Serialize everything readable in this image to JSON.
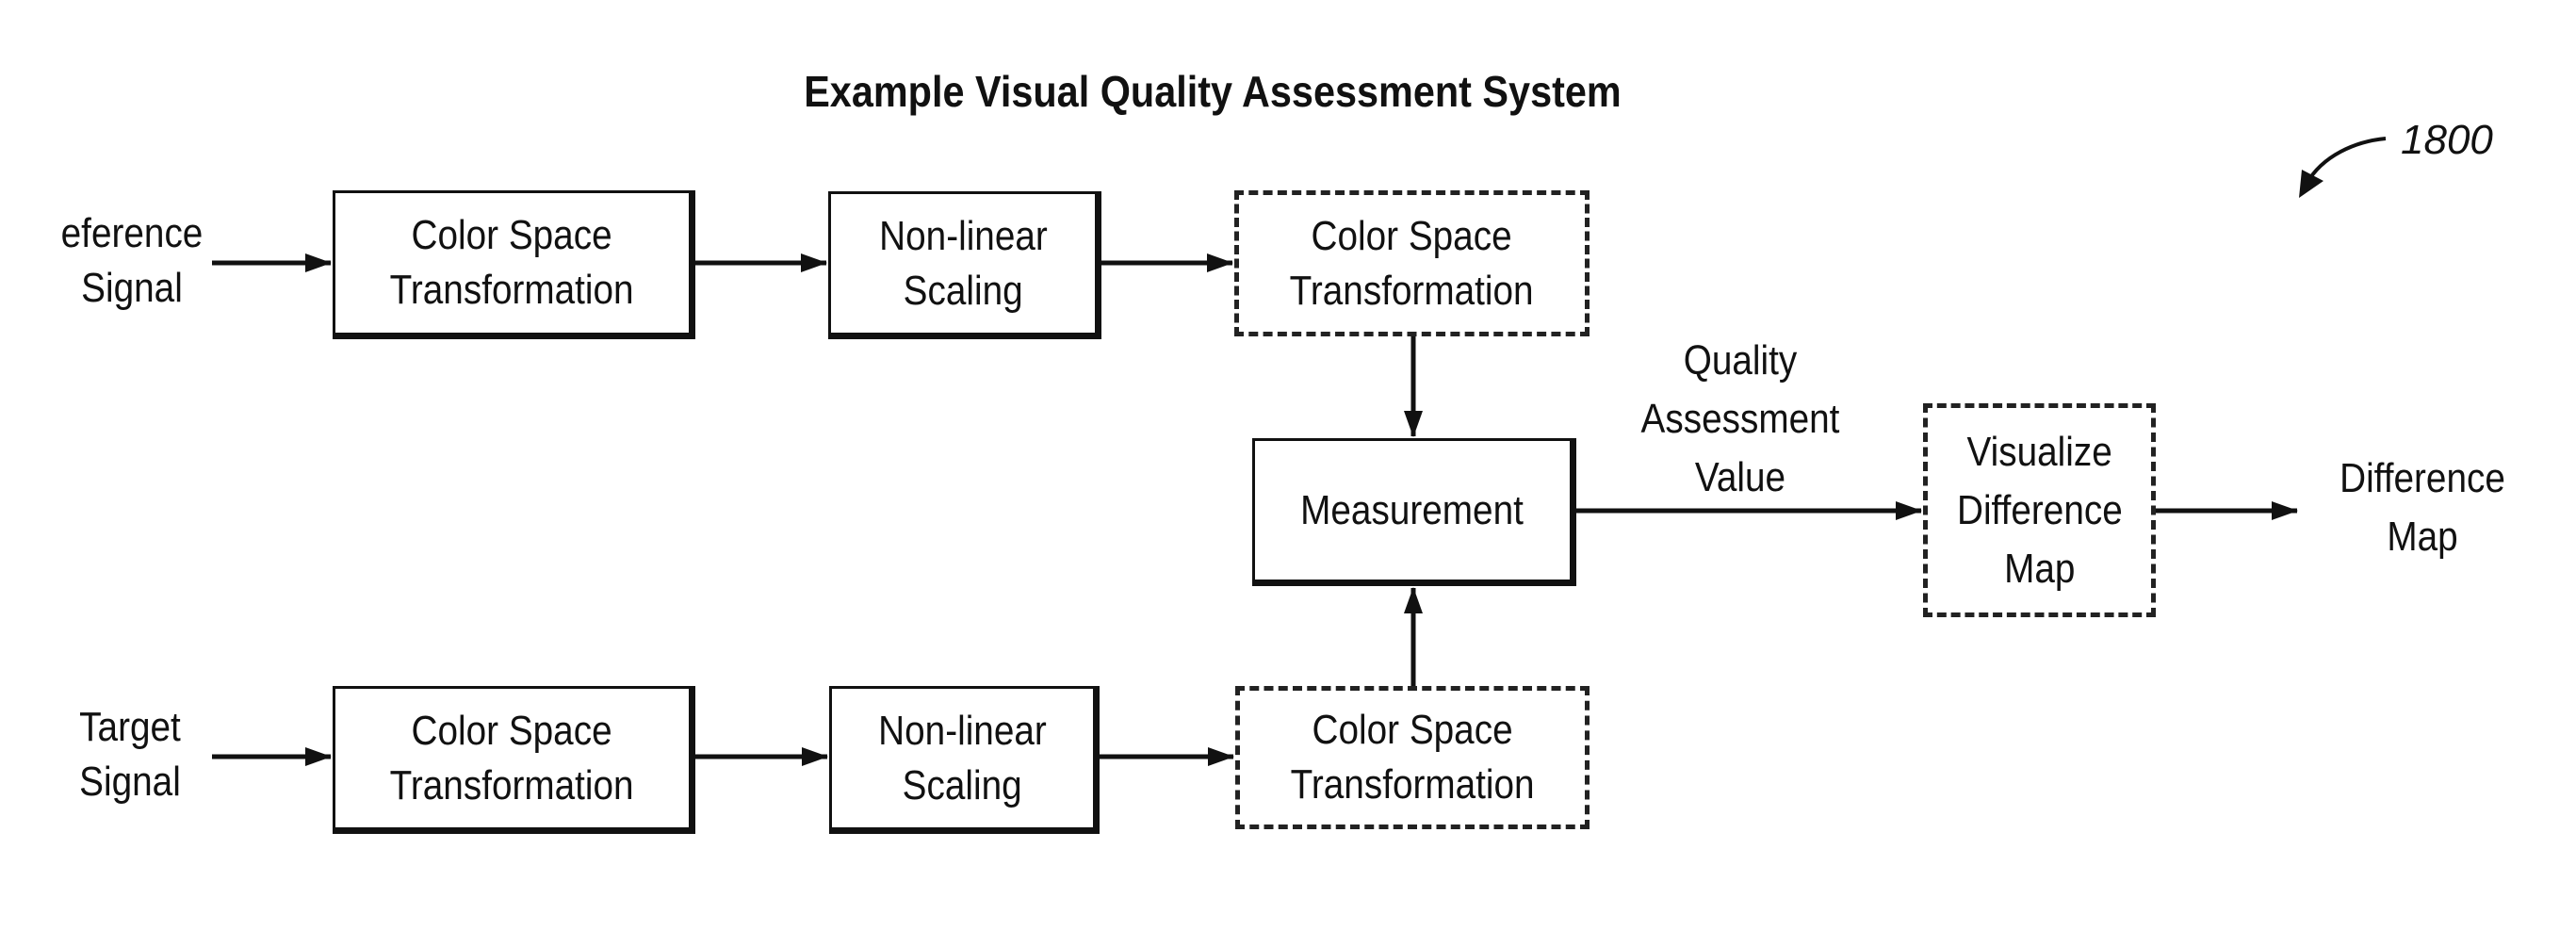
{
  "title": "Example Visual Quality Assessment System",
  "figure_number": "1800",
  "inputs": {
    "reference": [
      "eference",
      "Signal"
    ],
    "target": [
      "Target",
      "Signal"
    ]
  },
  "top_row": {
    "color_space_1": [
      "Color Space",
      "Transformation"
    ],
    "nonlinear": [
      "Non-linear",
      "Scaling"
    ],
    "color_space_2": [
      "Color Space",
      "Transformation"
    ]
  },
  "bottom_row": {
    "color_space_1": [
      "Color Space",
      "Transformation"
    ],
    "nonlinear": [
      "Non-linear",
      "Scaling"
    ],
    "color_space_2": [
      "Color Space",
      "Transformation"
    ]
  },
  "measurement": "Measurement",
  "quality_value_label": [
    "Quality",
    "Assessment",
    "Value"
  ],
  "visualize": [
    "Visualize",
    "Difference",
    "Map"
  ],
  "output_label": [
    "Difference",
    "Map"
  ],
  "colors": {
    "line": "#111111",
    "background": "#ffffff"
  }
}
